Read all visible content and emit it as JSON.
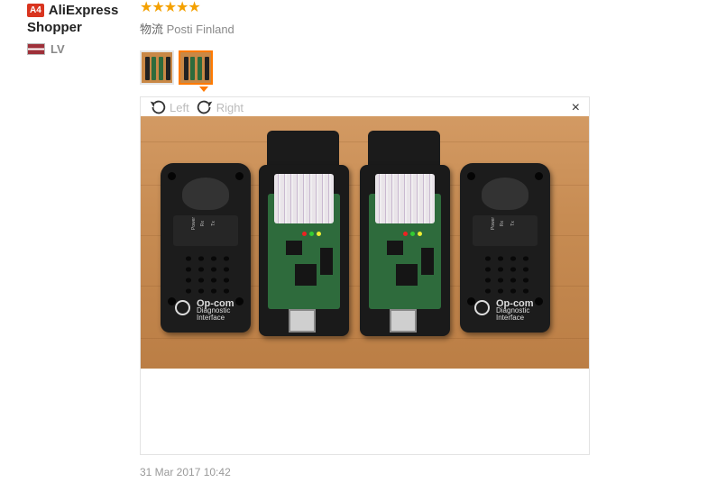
{
  "reviewer": {
    "level_badge": "A4",
    "name_line1": "AliExpress",
    "name_line2": "Shopper",
    "country_code": "LV",
    "country_flag": "latvia-flag"
  },
  "review": {
    "rating": 5,
    "stars_text": "★★★★★",
    "shipping_label": "物流",
    "shipping_value": "Posti Finland",
    "thumbnails": [
      {
        "name": "review-thumb-1",
        "active": false
      },
      {
        "name": "review-thumb-2",
        "active": true
      }
    ],
    "date": "31 Mar 2017 10:42"
  },
  "viewer": {
    "rotate_left_label": "Left",
    "rotate_right_label": "Right",
    "close_glyph": "×"
  },
  "photo": {
    "device_brand": "Op-com",
    "device_sub1": "Diagnostic",
    "device_sub2": "Interface",
    "led_labels": [
      "Power",
      "Rx",
      "Tx"
    ]
  },
  "colors": {
    "accent": "#ff7a00",
    "star": "#f4a100",
    "badge": "#d9341f"
  }
}
